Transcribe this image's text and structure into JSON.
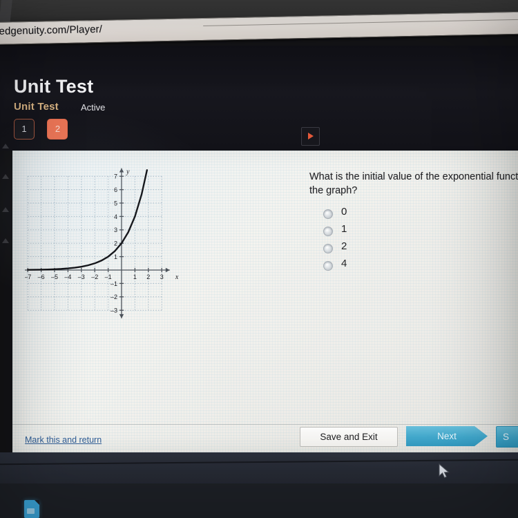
{
  "browser": {
    "url": ".edgenuity.com/Player/"
  },
  "header": {
    "title": "Unit Test",
    "breadcrumb": "Unit Test",
    "status": "Active",
    "question_buttons": [
      {
        "label": "1",
        "state": "outline"
      },
      {
        "label": "2",
        "state": "filled"
      }
    ],
    "play_icon": "play-icon"
  },
  "question": {
    "text": "What is the initial value of the exponential function",
    "text_line2": "the graph?",
    "options": [
      {
        "label": "0",
        "selected": false
      },
      {
        "label": "1",
        "selected": false
      },
      {
        "label": "2",
        "selected": false
      },
      {
        "label": "4",
        "selected": false
      }
    ]
  },
  "footer": {
    "mark_return": "Mark this and return",
    "save_exit": "Save and Exit",
    "next": "Next",
    "submit": "S"
  },
  "taskbar": {
    "icon": "document-icon"
  },
  "colors": {
    "accent_orange": "#ea7354",
    "accent_teal": "#3da6cb",
    "breadcrumb_tan": "#d9b483",
    "link_blue": "#2f5d96",
    "panel_bg": "#f0efec",
    "header_bg": "#15151b"
  },
  "chart_data": {
    "type": "line",
    "title": "",
    "xlabel": "x",
    "ylabel": "y",
    "xlim": [
      -7.6,
      3.6
    ],
    "ylim": [
      -3.6,
      7.6
    ],
    "xticks": [
      -7,
      -6,
      -5,
      -4,
      -3,
      -2,
      -1,
      1,
      2,
      3
    ],
    "yticks": [
      7,
      6,
      5,
      4,
      3,
      2,
      1,
      -1,
      -2,
      -3
    ],
    "grid": true,
    "grid_xrange": [
      -7,
      3
    ],
    "grid_yrange": [
      -3,
      7
    ],
    "function": "y = 2 * 2^x",
    "series": [
      {
        "name": "exponential",
        "x": [
          -7,
          -6.5,
          -6,
          -5.5,
          -5,
          -4.5,
          -4,
          -3.5,
          -3,
          -2.5,
          -2,
          -1.5,
          -1,
          -0.5,
          0,
          0.5,
          1,
          1.5,
          1.9
        ],
        "y": [
          0.016,
          0.022,
          0.031,
          0.044,
          0.063,
          0.088,
          0.125,
          0.177,
          0.25,
          0.354,
          0.5,
          0.707,
          1.0,
          1.414,
          2.0,
          2.828,
          4.0,
          5.657,
          7.46
        ]
      }
    ],
    "key_points": [
      {
        "x": -1,
        "y": 1
      },
      {
        "x": 0,
        "y": 2
      },
      {
        "x": 1,
        "y": 4
      }
    ],
    "asymptote": "y = 0"
  }
}
